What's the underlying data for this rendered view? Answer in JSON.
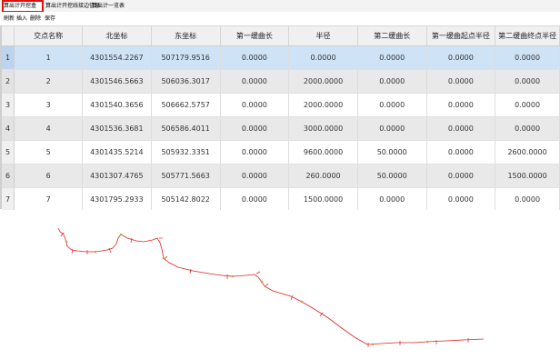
{
  "toolbar": {
    "tabs": [
      {
        "label": "算出计开挖盒",
        "active": true
      },
      {
        "label": "算出计开挖线接边信息",
        "active": false
      },
      {
        "label": "算出计一览表",
        "active": false
      }
    ]
  },
  "subtoolbar": {
    "buttons": [
      "刷新",
      "插入",
      "删除",
      "保存"
    ]
  },
  "table": {
    "columns": [
      "交点名称",
      "北坐标",
      "东坐标",
      "第一缓曲长",
      "半径",
      "第二缓曲长",
      "第一缓曲起点半径",
      "第二缓曲终点半径"
    ],
    "rows": [
      {
        "index": "1",
        "cells": [
          "1",
          "4301554.2267",
          "507179.9516",
          "0.0000",
          "0.0000",
          "0.0000",
          "0.0000",
          "0.0000"
        ]
      },
      {
        "index": "2",
        "cells": [
          "2",
          "4301546.5663",
          "506036.3017",
          "0.0000",
          "2000.0000",
          "0.0000",
          "0.0000",
          "0.0000"
        ]
      },
      {
        "index": "3",
        "cells": [
          "3",
          "4301540.3656",
          "506662.5757",
          "0.0000",
          "2000.0000",
          "0.0000",
          "0.0000",
          "0.0000"
        ]
      },
      {
        "index": "4",
        "cells": [
          "4",
          "4301536.3681",
          "506586.4011",
          "0.0000",
          "3000.0000",
          "0.0000",
          "0.0000",
          "0.0000"
        ]
      },
      {
        "index": "5",
        "cells": [
          "5",
          "4301435.5214",
          "505932.3351",
          "0.0000",
          "9600.0000",
          "50.0000",
          "0.0000",
          "2600.0000"
        ]
      },
      {
        "index": "6",
        "cells": [
          "6",
          "4301307.4765",
          "505771.5663",
          "0.0000",
          "260.0000",
          "50.0000",
          "0.0000",
          "1500.0000"
        ]
      },
      {
        "index": "7",
        "cells": [
          "7",
          "4301795.2933",
          "505142.8022",
          "0.0000",
          "1500.0000",
          "0.0000",
          "0.0000",
          "0.0000"
        ]
      }
    ]
  },
  "colors": {
    "route_line": "#dd2222",
    "selected_row": "#cfe3f7",
    "active_tab_outline": "#e01010"
  }
}
